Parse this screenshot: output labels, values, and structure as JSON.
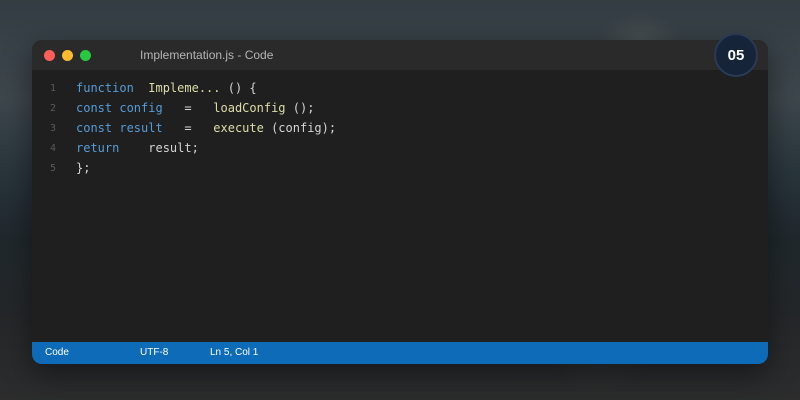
{
  "window": {
    "title": "Implementation.js - Code"
  },
  "editor": {
    "lines": [
      {
        "number": "1",
        "tokens": [
          {
            "text": "function",
            "kind": "kw"
          },
          {
            "text": "  ",
            "kind": "plain"
          },
          {
            "text": "Impleme...",
            "kind": "fn"
          },
          {
            "text": " () {",
            "kind": "plain"
          }
        ]
      },
      {
        "number": "2",
        "tokens": [
          {
            "text": "const config",
            "kind": "kw"
          },
          {
            "text": "   =   ",
            "kind": "plain"
          },
          {
            "text": "loadConfig",
            "kind": "fn"
          },
          {
            "text": " ();",
            "kind": "plain"
          }
        ]
      },
      {
        "number": "3",
        "tokens": [
          {
            "text": "const result",
            "kind": "kw"
          },
          {
            "text": "   =   ",
            "kind": "plain"
          },
          {
            "text": "execute",
            "kind": "fn"
          },
          {
            "text": " (config);",
            "kind": "plain"
          }
        ]
      },
      {
        "number": "4",
        "tokens": [
          {
            "text": "return",
            "kind": "kw"
          },
          {
            "text": "    result;",
            "kind": "plain"
          }
        ]
      },
      {
        "number": "5",
        "tokens": [
          {
            "text": "};",
            "kind": "plain"
          }
        ]
      }
    ]
  },
  "statusbar": {
    "mode": "Code",
    "encoding": "UTF-8",
    "position": "Ln 5, Col 1"
  },
  "badge": {
    "number": "05"
  },
  "colors": {
    "statusbar": "#0e6bb8",
    "keyword": "#569cd6",
    "function": "#dcdcaa",
    "text": "#d4d4d4",
    "close": "#ff5f57",
    "minimize": "#febc2e",
    "maximize": "#28c840"
  }
}
